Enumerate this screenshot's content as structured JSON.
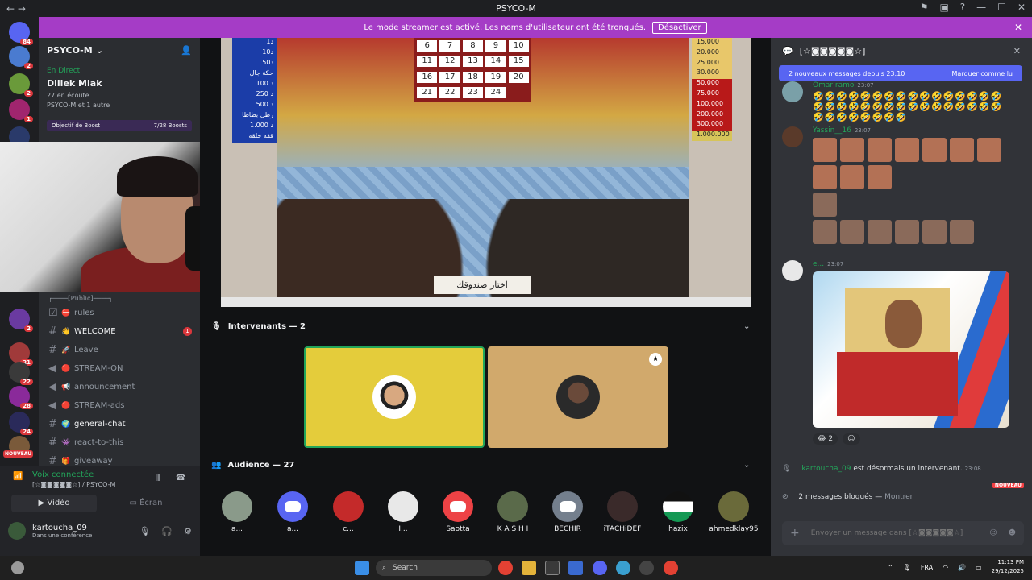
{
  "window": {
    "title": "PSYCO-M",
    "nav": "← →"
  },
  "banner": {
    "text": "Le mode streamer est activé. Les noms d'utilisateur ont été tronqués.",
    "button": "Désactiver"
  },
  "server_badges": [
    "84",
    "2",
    "2",
    "1",
    "13",
    "2",
    "21",
    "22",
    "28",
    "24"
  ],
  "server_new_label": "NOUVEAU",
  "server": {
    "name": "PSYCO-M"
  },
  "live_event": {
    "label": "En Direct",
    "title": "Dlilek Mlak",
    "listeners": "27 en écoute",
    "members": "PSYCO-M et 1 autre"
  },
  "boost": {
    "label": "Objectif de Boost",
    "progress": "7/28 Boosts"
  },
  "category_label": "┌────[Public]────┐",
  "channels": [
    {
      "name": "rules",
      "emoji": "⛔"
    },
    {
      "name": "WELCOME",
      "emoji": "👋",
      "unread": true,
      "mentions": "1"
    },
    {
      "name": "Leave",
      "emoji": "🚀"
    },
    {
      "name": "STREAM-ON",
      "emoji": "🔴"
    },
    {
      "name": "announcement",
      "emoji": "📢"
    },
    {
      "name": "STREAM-ads",
      "emoji": "🔴"
    },
    {
      "name": "general-chat",
      "emoji": "🌍",
      "unread": true
    },
    {
      "name": "react-to-this",
      "emoji": "👾"
    },
    {
      "name": "giveaway",
      "emoji": "🎁"
    }
  ],
  "voice": {
    "status": "Voix connectée",
    "location": "[☆◙◙◙◙◙☆] / PSYCO-M",
    "video_label": "Vidéo",
    "screen_label": "Écran"
  },
  "user": {
    "name": "kartoucha_09",
    "status": "Dans une conférence"
  },
  "stream": {
    "left_prizes": [
      "1د",
      "10د",
      "50د",
      "حكة جال",
      "100 د",
      "250 د",
      "500 د",
      "رطل بطاطا",
      "1.000 د",
      "قفة حلقة"
    ],
    "right_prizes": [
      "15.000",
      "20.000",
      "25.000",
      "30.000",
      "50.000",
      "75.000",
      "100.000",
      "200.000",
      "300.000",
      "1.000.000"
    ],
    "boxes": [
      "6",
      "7",
      "8",
      "9",
      "10",
      "11",
      "12",
      "13",
      "14",
      "15",
      "16",
      "17",
      "18",
      "19",
      "20",
      "21",
      "22",
      "23",
      "24"
    ],
    "caption": "اختار صندوقك"
  },
  "speakers_header": "Intervenants — 2",
  "audience_header": "Audience — 27",
  "audience": [
    "a...",
    "a...",
    "c...",
    "I...",
    "Saotta",
    "K A S H I",
    "BECHIR",
    "iTACHiDEF",
    "hazix",
    "ahmedklay95"
  ],
  "chat": {
    "channel": "[☆◙◙◙◙◙☆]",
    "new_messages": "2 nouveaux messages depuis 23:10",
    "mark_read": "Marquer comme lu",
    "messages": [
      {
        "author": "Omar ramo",
        "time": "23:07",
        "emojis": "🤣🤣🤣🤣🤣🤣🤣🤣🤣🤣🤣🤣🤣🤣🤣🤣🤣🤣🤣🤣🤣🤣🤣🤣🤣🤣🤣🤣🤣🤣🤣🤣🤣🤣🤣🤣🤣🤣🤣🤣"
      },
      {
        "author": "Yassin__16",
        "time": "23:07"
      },
      {
        "author": "e...",
        "time": "23:07"
      }
    ],
    "reaction_count": "2",
    "system_user": "kartoucha_09",
    "system_text": "est désormais un intervenant.",
    "system_time": "23:08",
    "new_label": "NOUVEAU",
    "blocked": "2 messages bloqués —",
    "blocked_show": "Montrer",
    "composer_placeholder": "Envoyer un message dans [☆◙◙◙◙◙☆]"
  },
  "taskbar": {
    "search": "Search",
    "lang": "FRA",
    "time": "11:13 PM",
    "date": "29/12/2025"
  }
}
